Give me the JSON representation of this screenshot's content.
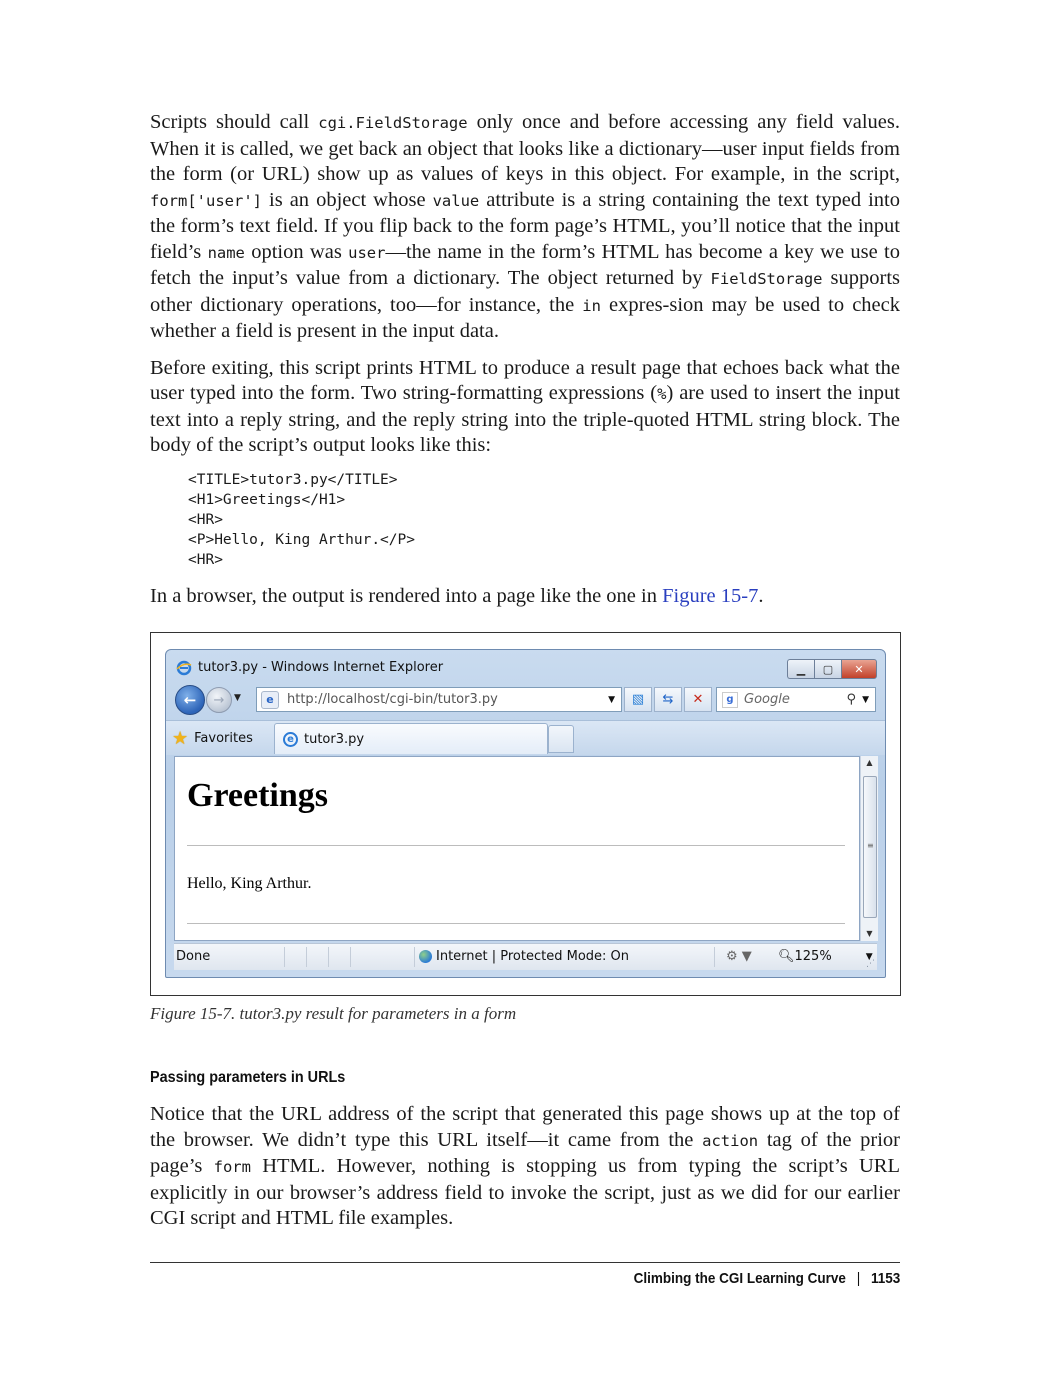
{
  "paragraphs": {
    "p1": {
      "t1": "Scripts should call ",
      "c1": "cgi.FieldStorage",
      "t2": " only once and before accessing any field values. When it is called, we get back an object that looks like a dictionary—user input fields from the form (or URL) show up as values of keys in this object. For example, in the script, ",
      "c2": "form['user']",
      "t3": " is an object whose ",
      "c3": "value",
      "t4": " attribute is a string containing the text typed into the form’s text field. If you flip back to the form page’s HTML, you’ll notice that the input field’s ",
      "c4": "name",
      "t5": " option was ",
      "c5": "user",
      "t6": "—the name in the form’s HTML has become a key we use to fetch the input’s value from a dictionary. The object returned by ",
      "c6": "FieldStorage",
      "t7": " supports other dictionary operations, too—for instance, the ",
      "c7": "in",
      "t8": " expres-sion may be used to check whether a field is present in the input data."
    },
    "p2": {
      "t1": "Before exiting, this script prints HTML to produce a result page that echoes back what the user typed into the form. Two string-formatting expressions (",
      "c1": "%",
      "t2": ") are used to insert the input text into a reply string, and the reply string into the triple-quoted HTML string block. The body of the script’s output looks like this:"
    },
    "code_lines": [
      "<TITLE>tutor3.py</TITLE>",
      "<H1>Greetings</H1>",
      "<HR>",
      "<P>Hello, King Arthur.</P>",
      "<HR>"
    ],
    "p_fig": {
      "t1": "In a browser, the output is rendered into a page like the one in ",
      "link": "Figure 15-7",
      "t2": "."
    },
    "p3": {
      "t1": "Notice that the URL address of the script that generated this page shows up at the top of the browser. We didn’t type this URL itself—it came from the ",
      "c1": "action",
      "t2": " tag of the prior page’s ",
      "c2": "form",
      "t3": " HTML. However, nothing is stopping us from typing the script’s URL explicitly in our browser’s address field to invoke the script, just as we did for our earlier CGI script and HTML file examples."
    }
  },
  "browser": {
    "window_title": "tutor3.py - Windows Internet Explorer",
    "address": "http://localhost/cgi-bin/tutor3.py",
    "search_placeholder": "Google",
    "favorites_label": "Favorites",
    "tab_label": "tutor3.py",
    "page_heading": "Greetings",
    "page_text": "Hello, King Arthur.",
    "status_text": "Done",
    "zone_text": "Internet | Protected Mode: On",
    "zoom": "125%"
  },
  "figure_caption": "Figure 15-7. tutor3.py result for parameters in a form",
  "subheading": "Passing parameters in URLs",
  "footer": {
    "section": "Climbing the CGI Learning Curve",
    "page_number": "1153"
  }
}
